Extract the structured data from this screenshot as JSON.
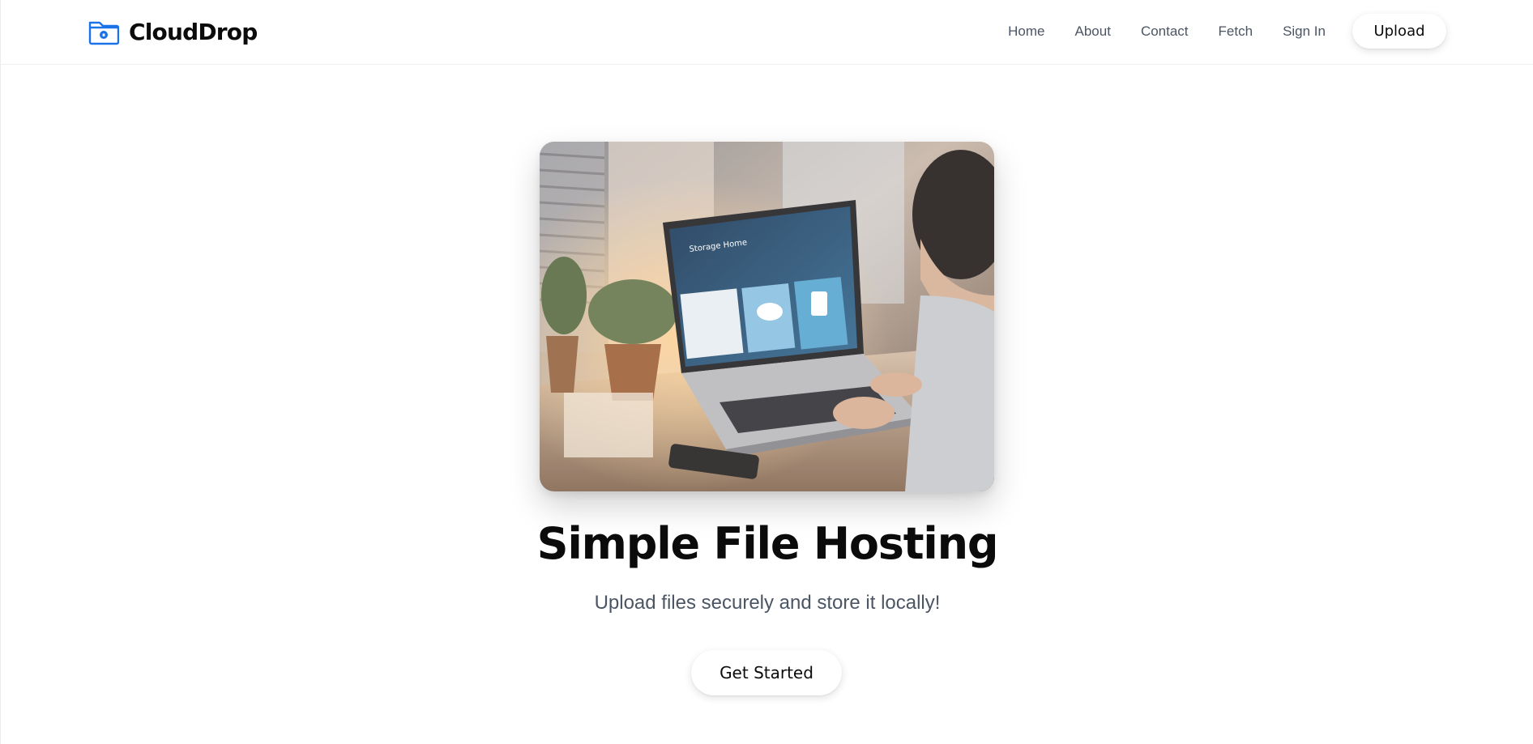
{
  "brand": {
    "name": "CloudDrop",
    "icon": "folder-lock-icon",
    "icon_color": "#1a73e8"
  },
  "nav": {
    "links": [
      "Home",
      "About",
      "Contact",
      "Fetch",
      "Sign In"
    ],
    "upload_label": "Upload"
  },
  "hero": {
    "image_alt": "Person using a laptop showing a cloud storage app",
    "screen_text": "Storage Home",
    "title": "Simple File Hosting",
    "subtitle": "Upload files securely and store it locally!",
    "cta_label": "Get Started"
  }
}
